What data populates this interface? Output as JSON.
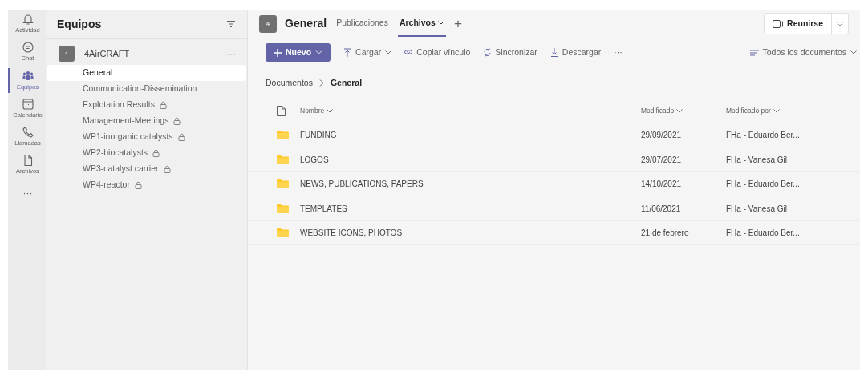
{
  "rail": [
    {
      "label": "Actividad",
      "kind": "bell",
      "selected": false
    },
    {
      "label": "Chat",
      "kind": "chat",
      "selected": false
    },
    {
      "label": "Equipos",
      "kind": "teams",
      "selected": true
    },
    {
      "label": "Calendario",
      "kind": "calendar",
      "selected": false
    },
    {
      "label": "Llamadas",
      "kind": "phone",
      "selected": false
    },
    {
      "label": "Archivos",
      "kind": "file",
      "selected": false
    }
  ],
  "rail_more": "···",
  "teams_panel": {
    "title": "Equipos",
    "team": {
      "avatar": "4",
      "name": "4AirCRAFT",
      "more": "···"
    },
    "channels": [
      {
        "name": "General",
        "selected": true,
        "locked": false
      },
      {
        "name": "Communication-Dissemination",
        "selected": false,
        "locked": false
      },
      {
        "name": "Explotation Results",
        "selected": false,
        "locked": true
      },
      {
        "name": "Management-Meetings",
        "selected": false,
        "locked": true
      },
      {
        "name": "WP1-inorganic catalysts",
        "selected": false,
        "locked": true
      },
      {
        "name": "WP2-biocatalysts",
        "selected": false,
        "locked": true
      },
      {
        "name": "WP3-catalyst carrier",
        "selected": false,
        "locked": true
      },
      {
        "name": "WP4-reactor",
        "selected": false,
        "locked": true
      }
    ]
  },
  "header": {
    "avatar": "4",
    "title": "General",
    "tabs": [
      {
        "label": "Publicaciones",
        "selected": false,
        "dropdown": false
      },
      {
        "label": "Archivos",
        "selected": true,
        "dropdown": true
      }
    ],
    "add": "+",
    "meet_button": "Reunirse"
  },
  "toolbar": {
    "new_button": "Nuevo",
    "actions": [
      {
        "label": "Cargar",
        "kind": "upload",
        "dropdown": true
      },
      {
        "label": "Copiar vínculo",
        "kind": "link",
        "dropdown": false
      },
      {
        "label": "Sincronizar",
        "kind": "sync",
        "dropdown": false
      },
      {
        "label": "Descargar",
        "kind": "download",
        "dropdown": false
      }
    ],
    "more": "···",
    "view": "Todos los documentos"
  },
  "breadcrumb": [
    "Documentos",
    "General"
  ],
  "table": {
    "columns": [
      "Nombre",
      "Modificado",
      "Modificado por"
    ],
    "rows": [
      [
        "FUNDING",
        "29/09/2021",
        "FHa - Eduardo Ber..."
      ],
      [
        "LOGOS",
        "29/07/2021",
        "FHa - Vanesa Gil"
      ],
      [
        "NEWS, PUBLICATIONS, PAPERS",
        "14/10/2021",
        "FHa - Eduardo Ber..."
      ],
      [
        "TEMPLATES",
        "11/06/2021",
        "FHa - Vanesa Gil"
      ],
      [
        "WEBSITE ICONS, PHOTOS",
        "21 de febrero",
        "FHa - Eduardo Ber..."
      ]
    ]
  }
}
